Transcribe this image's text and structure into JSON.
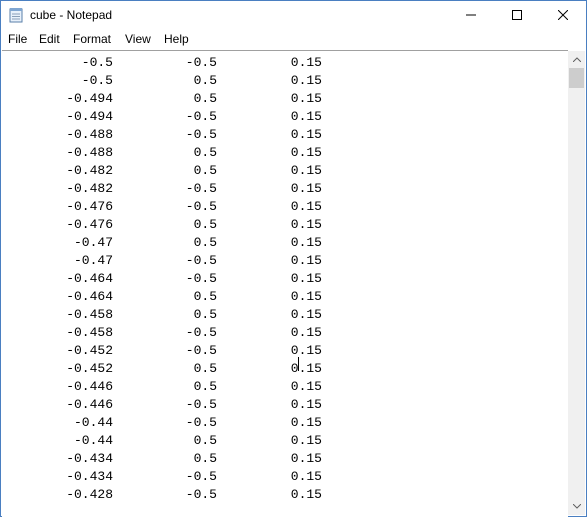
{
  "window": {
    "title": "cube - Notepad"
  },
  "menu": {
    "file": "File",
    "edit": "Edit",
    "format": "Format",
    "view": "View",
    "help": "Help"
  },
  "icons": {
    "app": "notepad-icon",
    "minimize": "minimize-icon",
    "maximize": "maximize-icon",
    "close": "close-icon",
    "scroll_up": "scroll-up-icon",
    "scroll_down": "scroll-down-icon"
  },
  "editor": {
    "rows": [
      [
        "-0.5",
        "-0.5",
        "0.15"
      ],
      [
        "-0.5",
        "0.5",
        "0.15"
      ],
      [
        "-0.494",
        "0.5",
        "0.15"
      ],
      [
        "-0.494",
        "-0.5",
        "0.15"
      ],
      [
        "-0.488",
        "-0.5",
        "0.15"
      ],
      [
        "-0.488",
        "0.5",
        "0.15"
      ],
      [
        "-0.482",
        "0.5",
        "0.15"
      ],
      [
        "-0.482",
        "-0.5",
        "0.15"
      ],
      [
        "-0.476",
        "-0.5",
        "0.15"
      ],
      [
        "-0.476",
        "0.5",
        "0.15"
      ],
      [
        "-0.47",
        "0.5",
        "0.15"
      ],
      [
        "-0.47",
        "-0.5",
        "0.15"
      ],
      [
        "-0.464",
        "-0.5",
        "0.15"
      ],
      [
        "-0.464",
        "0.5",
        "0.15"
      ],
      [
        "-0.458",
        "0.5",
        "0.15"
      ],
      [
        "-0.458",
        "-0.5",
        "0.15"
      ],
      [
        "-0.452",
        "-0.5",
        "0.15"
      ],
      [
        "-0.452",
        "0.5",
        "0.15"
      ],
      [
        "-0.446",
        "0.5",
        "0.15"
      ],
      [
        "-0.446",
        "-0.5",
        "0.15"
      ],
      [
        "-0.44",
        "-0.5",
        "0.15"
      ],
      [
        "-0.44",
        "0.5",
        "0.15"
      ],
      [
        "-0.434",
        "0.5",
        "0.15"
      ],
      [
        "-0.434",
        "-0.5",
        "0.15"
      ],
      [
        "-0.428",
        "-0.5",
        "0.15"
      ]
    ]
  },
  "colors": {
    "window_border": "#4a7fc1",
    "scrollbar_track": "#f0f0f0",
    "scrollbar_thumb": "#cdcdcd"
  }
}
